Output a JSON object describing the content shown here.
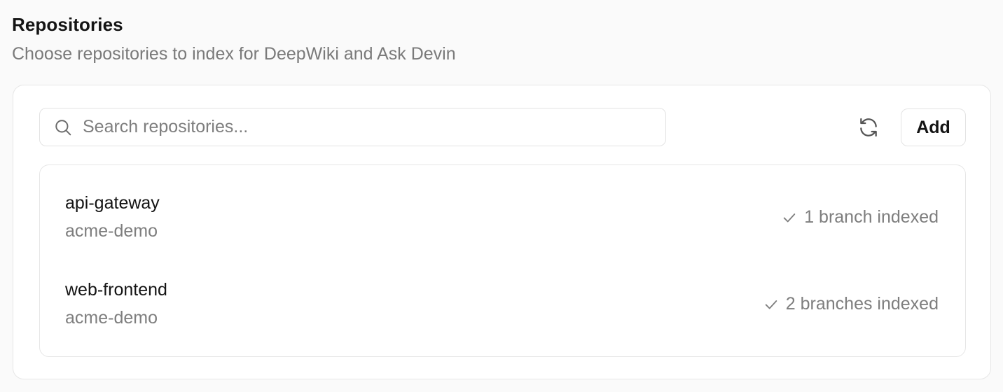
{
  "section": {
    "title": "Repositories",
    "subtitle": "Choose repositories to index for DeepWiki and Ask Devin"
  },
  "toolbar": {
    "search_placeholder": "Search repositories...",
    "search_value": "",
    "search_icon": "search-icon",
    "refresh_icon": "refresh-icon",
    "add_label": "Add"
  },
  "repositories": [
    {
      "name": "api-gateway",
      "owner": "acme-demo",
      "status": "1 branch indexed",
      "status_icon": "check-icon"
    },
    {
      "name": "web-frontend",
      "owner": "acme-demo",
      "status": "2 branches indexed",
      "status_icon": "check-icon"
    }
  ],
  "colors": {
    "background": "#fafafa",
    "card": "#ffffff",
    "border": "#e6e6e6",
    "text_primary": "#141414",
    "text_muted": "#7e7e7e"
  }
}
